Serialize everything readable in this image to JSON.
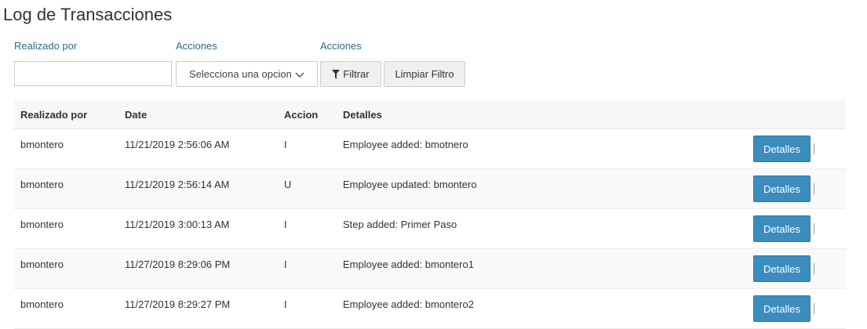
{
  "page": {
    "title": "Log de Transacciones"
  },
  "filters": {
    "realizado_label": "Realizado por",
    "realizado_value": "",
    "acciones_label": "Acciones",
    "acciones_select": "Selecciona una opcion",
    "acciones_label_2": "Acciones",
    "filter_button": "Filtrar",
    "clear_button": "Limpiar Filtro"
  },
  "table": {
    "headers": [
      "Realizado por",
      "Date",
      "Accion",
      "Detalles"
    ],
    "rows": [
      {
        "user": "bmontero",
        "date": "11/21/2019 2:56:06 AM",
        "action": "I",
        "details": "Employee added: bmotnero",
        "button": "Detalles",
        "sep": "|"
      },
      {
        "user": "bmontero",
        "date": "11/21/2019 2:56:14 AM",
        "action": "U",
        "details": "Employee updated: bmontero",
        "button": "Detalles",
        "sep": "|"
      },
      {
        "user": "bmontero",
        "date": "11/21/2019 3:00:13 AM",
        "action": "I",
        "details": "Step added: Primer Paso",
        "button": "Detalles",
        "sep": "|"
      },
      {
        "user": "bmontero",
        "date": "11/27/2019 8:29:06 PM",
        "action": "I",
        "details": "Employee added: bmontero1",
        "button": "Detalles",
        "sep": "|"
      },
      {
        "user": "bmontero",
        "date": "11/27/2019 8:29:27 PM",
        "action": "I",
        "details": "Employee added: bmontero2",
        "button": "Detalles",
        "sep": "|"
      }
    ]
  },
  "colors": {
    "accent": "#3a8dbe",
    "label": "#2e6c8a"
  },
  "icons": {
    "filter": "filter-icon",
    "dropdown": "chevron-down-icon"
  }
}
